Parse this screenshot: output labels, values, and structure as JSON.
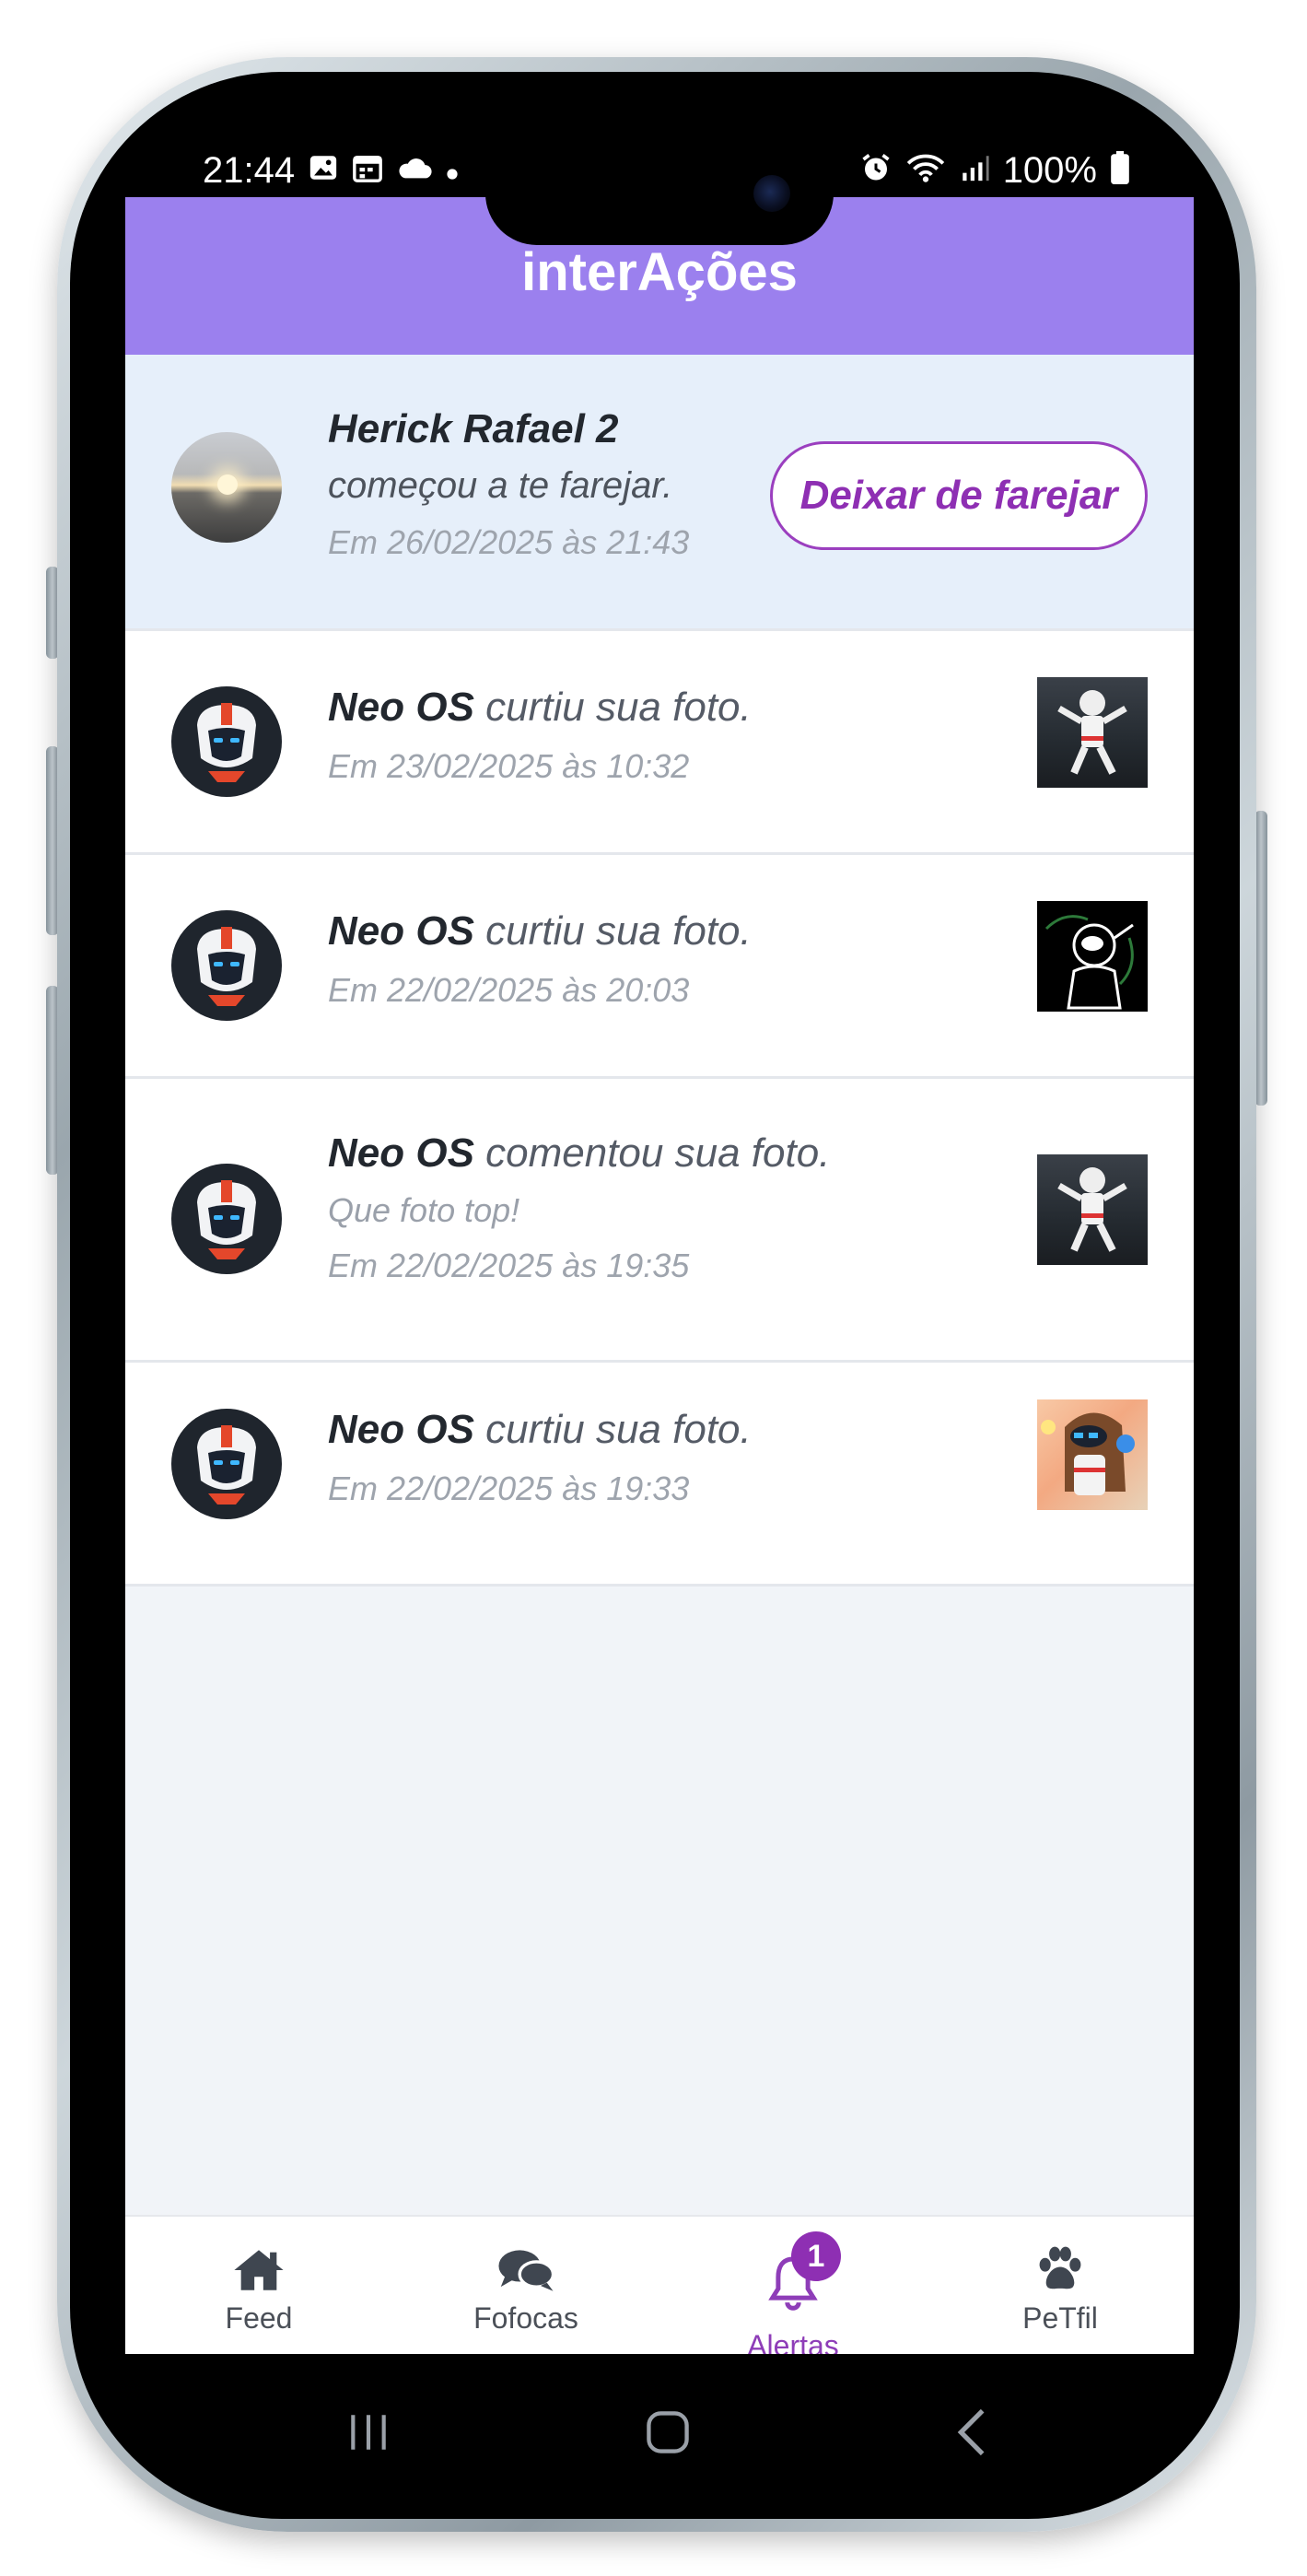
{
  "status_bar": {
    "time": "21:44",
    "left_icons": [
      "image-icon",
      "calendar-icon",
      "cloud-icon",
      "dot-icon"
    ],
    "right_icons": [
      "alarm-icon",
      "wifi-icon",
      "signal-icon"
    ],
    "battery": "100%"
  },
  "header": {
    "title": "interAções"
  },
  "notifications": [
    {
      "user": "Herick Rafael 2",
      "action": "começou a te farejar.",
      "date": "Em 26/02/2025 às 21:43",
      "button_label": "Deixar de farejar"
    },
    {
      "user": "Neo OS",
      "action": " curtiu sua foto.",
      "date": "Em 23/02/2025 às 10:32"
    },
    {
      "user": "Neo OS",
      "action": " curtiu sua foto.",
      "date": "Em 22/02/2025 às 20:03"
    },
    {
      "user": "Neo OS",
      "action": " comentou sua foto.",
      "comment": "Que foto top!",
      "date": "Em 22/02/2025 às 19:35"
    },
    {
      "user": "Neo OS",
      "action": " curtiu sua foto.",
      "date": "Em 22/02/2025 às 19:33"
    }
  ],
  "bottom_nav": {
    "items": [
      {
        "label": "Feed",
        "icon": "home-icon"
      },
      {
        "label": "Fofocas",
        "icon": "chat-bubbles-icon"
      },
      {
        "label": "Alertas",
        "icon": "bell-icon",
        "badge": "1",
        "active": true
      },
      {
        "label": "PeTfil",
        "icon": "paw-icon"
      }
    ]
  },
  "colors": {
    "header": "#9b80ee",
    "accent": "#8e2fb3",
    "highlight_row": "#e6effa",
    "background": "#f1f4f8"
  }
}
